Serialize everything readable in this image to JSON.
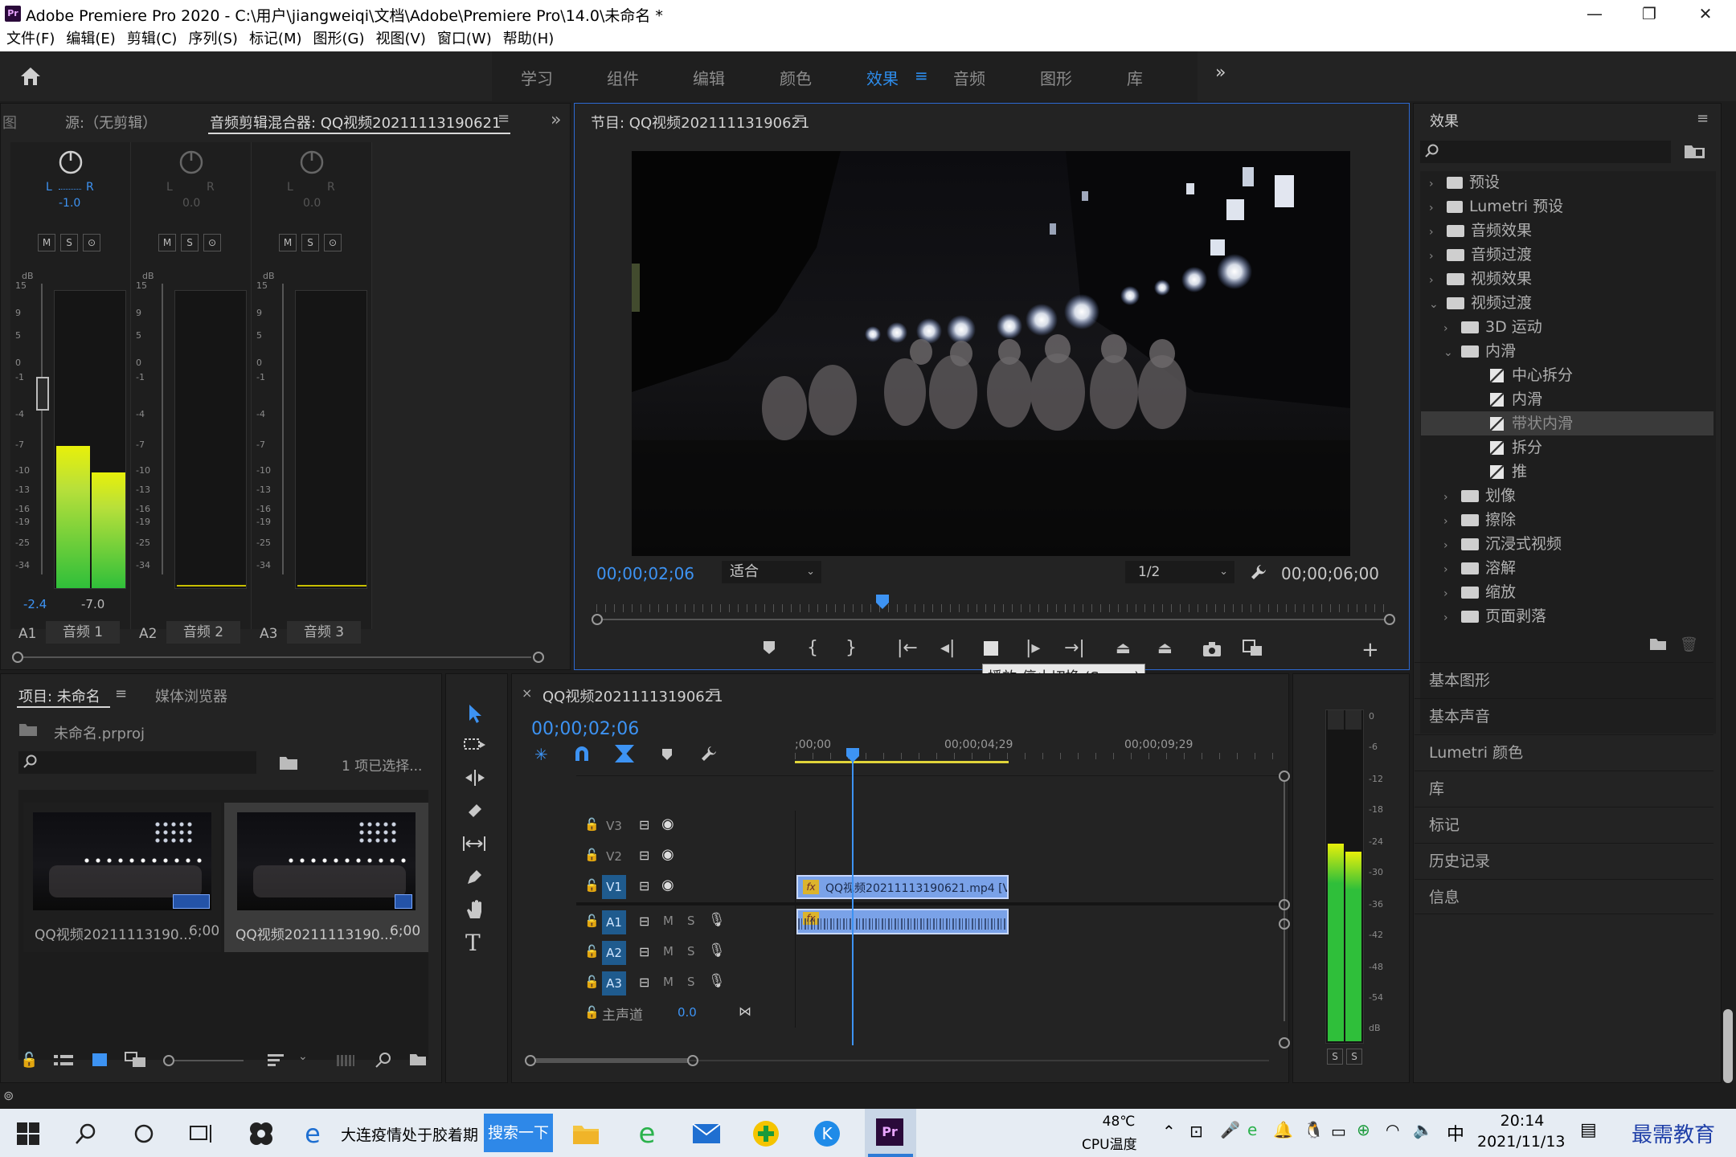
{
  "window": {
    "title": "Adobe Premiere Pro 2020 - C:\\用户\\jiangweiqi\\文档\\Adobe\\Premiere Pro\\14.0\\未命名 *",
    "app_icon_text": "Pr"
  },
  "menu": [
    "文件(F)",
    "编辑(E)",
    "剪辑(C)",
    "序列(S)",
    "标记(M)",
    "图形(G)",
    "视图(V)",
    "窗口(W)",
    "帮助(H)"
  ],
  "workspaces": [
    "学习",
    "组件",
    "编辑",
    "颜色",
    "效果",
    "音频",
    "图形",
    "库"
  ],
  "active_workspace": "效果",
  "source_panel": {
    "truncated_left": "图",
    "tab_source": "源:（无剪辑）",
    "tab_mixer": "音频剪辑混合器: QQ视频20211113190621"
  },
  "mixer": {
    "channels": [
      {
        "pan_l": "L",
        "pan_r": "R",
        "pan_value": "-1.0",
        "track": "A1",
        "name": "音频 1",
        "level_left": "-2.4",
        "level_right": "-7.0",
        "meter_left_fraction": 0.48,
        "meter_right_fraction": 0.39
      },
      {
        "pan_l": "L",
        "pan_r": "R",
        "pan_value": "0.0",
        "track": "A2",
        "name": "音频 2"
      },
      {
        "pan_l": "L",
        "pan_r": "R",
        "pan_value": "0.0",
        "track": "A3",
        "name": "音频 3"
      }
    ],
    "buttons": [
      "M",
      "S",
      "⊙"
    ],
    "db_label": "dB",
    "db_scale": [
      "15",
      "9",
      "5",
      "0",
      "-1",
      "-4",
      "-7",
      "-10",
      "-13",
      "-16",
      "-19",
      "-25",
      "-34",
      "-∞"
    ]
  },
  "program": {
    "title": "节目: QQ视频20211113190621",
    "timecode": "00;00;02;06",
    "fit": "适合",
    "resolution": "1/2",
    "duration": "00;00;06;00",
    "playhead_fraction": 0.36,
    "tooltip": "播放-停止切换 (Space)"
  },
  "effects": {
    "title": "效果",
    "tree": [
      {
        "label": "预设",
        "indent": 0,
        "kind": "preset",
        "open": false
      },
      {
        "label": "Lumetri 预设",
        "indent": 0,
        "kind": "preset",
        "open": false
      },
      {
        "label": "音频效果",
        "indent": 0,
        "kind": "folder",
        "open": false
      },
      {
        "label": "音频过渡",
        "indent": 0,
        "kind": "folder",
        "open": false
      },
      {
        "label": "视频效果",
        "indent": 0,
        "kind": "folder",
        "open": false
      },
      {
        "label": "视频过渡",
        "indent": 0,
        "kind": "folder",
        "open": true
      },
      {
        "label": "3D 运动",
        "indent": 1,
        "kind": "folder",
        "open": false
      },
      {
        "label": "内滑",
        "indent": 1,
        "kind": "folder",
        "open": true
      },
      {
        "label": "中心拆分",
        "indent": 2,
        "kind": "transition"
      },
      {
        "label": "内滑",
        "indent": 2,
        "kind": "transition"
      },
      {
        "label": "带状内滑",
        "indent": 2,
        "kind": "transition",
        "selected": true
      },
      {
        "label": "拆分",
        "indent": 2,
        "kind": "transition"
      },
      {
        "label": "推",
        "indent": 2,
        "kind": "transition"
      },
      {
        "label": "划像",
        "indent": 1,
        "kind": "folder",
        "open": false
      },
      {
        "label": "擦除",
        "indent": 1,
        "kind": "folder",
        "open": false
      },
      {
        "label": "沉浸式视频",
        "indent": 1,
        "kind": "folder",
        "open": false
      },
      {
        "label": "溶解",
        "indent": 1,
        "kind": "folder",
        "open": false
      },
      {
        "label": "缩放",
        "indent": 1,
        "kind": "folder",
        "open": false
      },
      {
        "label": "页面剥落",
        "indent": 1,
        "kind": "folder",
        "open": false
      }
    ],
    "sections": [
      "基本图形",
      "基本声音",
      "Lumetri 颜色",
      "库",
      "标记",
      "历史记录",
      "信息"
    ]
  },
  "project": {
    "tab_project": "项目: 未命名",
    "tab_media": "媒体浏览器",
    "file": "未命名.prproj",
    "selection": "1 项已选择...",
    "clips": [
      {
        "name": "QQ视频20211113190...",
        "duration": "6;00"
      },
      {
        "name": "QQ视频20211113190...",
        "duration": "6;00"
      }
    ]
  },
  "timeline": {
    "title": "QQ视频20211113190621",
    "timecode": "00;00;02;06",
    "ruler": [
      ";00;00",
      "00;00;04;29",
      "00;00;09;29"
    ],
    "video_tracks": [
      "V3",
      "V2",
      "V1"
    ],
    "audio_tracks": [
      "A1",
      "A2",
      "A3"
    ],
    "ms": [
      "M",
      "S"
    ],
    "master_label": "主声道",
    "master_value": "0.0",
    "video_clip": "QQ视频20211113190621.mp4 [V]",
    "fx": "fx"
  },
  "meter": {
    "scale": [
      "0",
      "-6",
      "-12",
      "-18",
      "-24",
      "-30",
      "-36",
      "-42",
      "-48",
      "-54",
      "dB"
    ],
    "solo": [
      "S",
      "S"
    ]
  },
  "taskbar": {
    "search_text": "大连疫情处于胶着期",
    "search_btn": "搜索一下",
    "temp": "48℃",
    "temp_label": "CPU温度",
    "ime": "中",
    "time": "20:14",
    "date": "2021/11/13",
    "watermark": "最需教育"
  }
}
